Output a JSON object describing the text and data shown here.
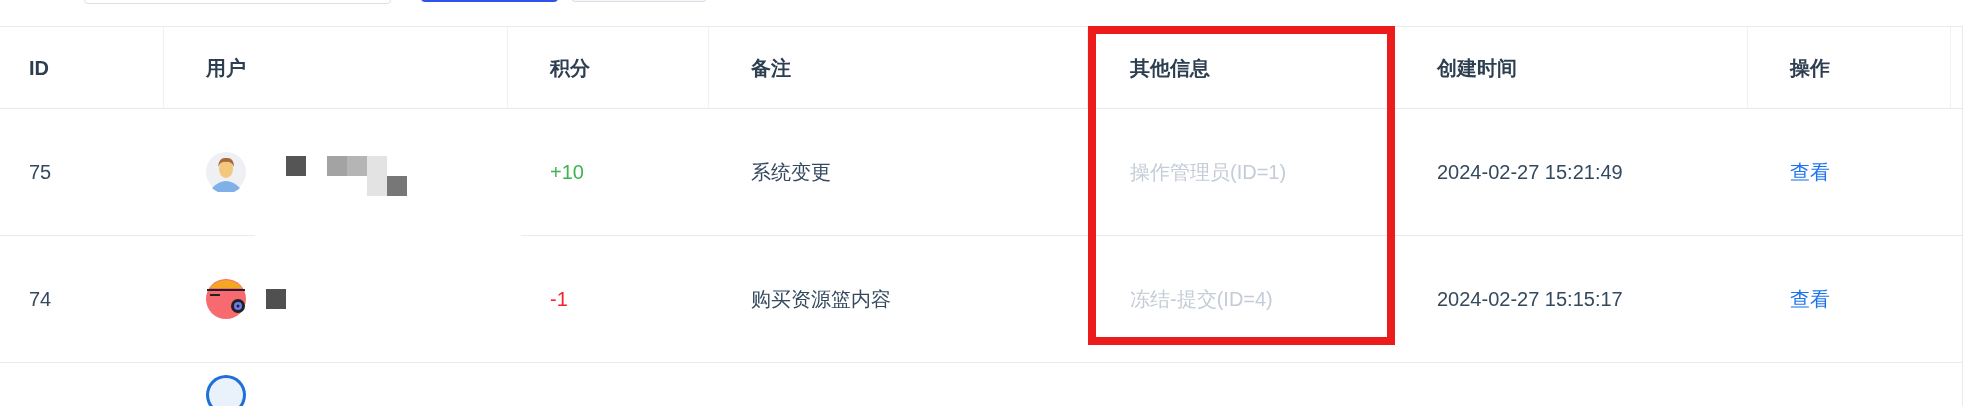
{
  "toolbar": {
    "controls": [
      {
        "kind": "field"
      },
      {
        "kind": "primary_button"
      },
      {
        "kind": "button"
      }
    ]
  },
  "table": {
    "columns": [
      {
        "label": "ID",
        "highlighted": false
      },
      {
        "label": "用户",
        "highlighted": false
      },
      {
        "label": "积分",
        "highlighted": false
      },
      {
        "label": "备注",
        "highlighted": false
      },
      {
        "label": "其他信息",
        "highlighted": true
      },
      {
        "label": "创建时间",
        "highlighted": false
      },
      {
        "label": "操作",
        "highlighted": false
      }
    ],
    "rows": [
      {
        "id": "75",
        "avatar": {
          "kind": "person"
        },
        "redacted_name": {
          "kind": "long"
        },
        "points": "+10",
        "color": "#3fb34f",
        "note": "系统变更",
        "other_info": "操作管理员(ID=1)",
        "created_at": "2024-02-27 15:21:49",
        "action": "查看"
      },
      {
        "id": "74",
        "avatar": {
          "kind": "red"
        },
        "redacted_name": {
          "kind": "short"
        },
        "points": "-1",
        "color": "#f5222d",
        "note": "购买资源篮内容",
        "other_info": "冻结-提交(ID=4)",
        "created_at": "2024-02-27 15:15:17",
        "action": "查看"
      },
      {
        "avatar": {
          "kind": "blue"
        }
      }
    ]
  }
}
